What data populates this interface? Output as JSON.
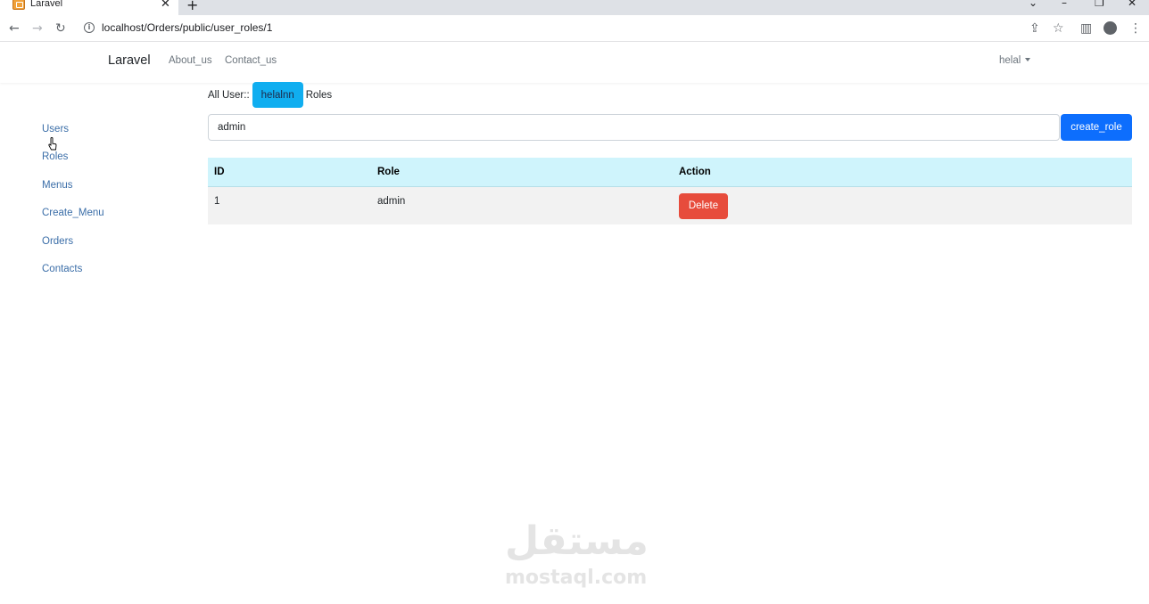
{
  "browser": {
    "tab_title": "Laravel",
    "tab_close": "✕",
    "new_tab": "+",
    "url": "localhost/Orders/public/user_roles/1"
  },
  "navbar": {
    "brand": "Laravel",
    "links": [
      "About_us",
      "Contact_us"
    ],
    "user": "helal"
  },
  "sidebar": {
    "items": [
      "Users",
      "Roles",
      "Menus",
      "Create_Menu",
      "Orders",
      "Contacts"
    ]
  },
  "breadcrumb": {
    "all_users": "All User::",
    "current_user": "helalnn",
    "section": "Roles"
  },
  "form": {
    "role_value": "admin",
    "submit_label": "create_role"
  },
  "table": {
    "columns": [
      "ID",
      "Role",
      "Action"
    ],
    "rows": [
      {
        "id": "1",
        "role": "admin",
        "action": "Delete"
      }
    ]
  },
  "watermark": {
    "arabic": "مستقل",
    "latin": "mostaql.com"
  },
  "colors": {
    "accent": "#0d6efd",
    "pill": "#10aef0",
    "danger": "#e74c3c",
    "table_header": "#cff4fc"
  }
}
